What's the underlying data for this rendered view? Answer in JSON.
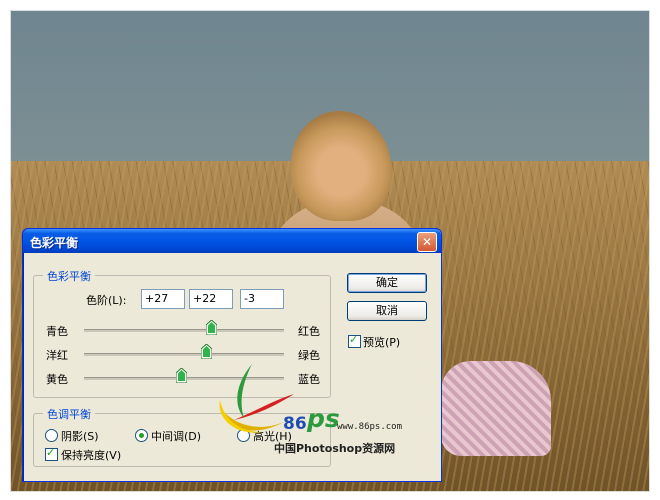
{
  "dialog": {
    "title": "色彩平衡",
    "close_glyph": "✕",
    "color_balance_group": {
      "label": "色彩平衡",
      "levels_label": "色阶(L):",
      "values": [
        "+27",
        "+22",
        "-3"
      ]
    },
    "sliders": [
      {
        "left": "青色",
        "right": "红色",
        "value": 27
      },
      {
        "left": "洋红",
        "right": "绿色",
        "value": 22
      },
      {
        "left": "黄色",
        "right": "蓝色",
        "value": -3
      }
    ],
    "tone_group": {
      "label": "色调平衡",
      "shadows": "阴影(S)",
      "midtones": "中间调(D)",
      "highlights": "高光(H)",
      "selected": "midtones",
      "preserve_luminosity": "保持亮度(V)",
      "preserve_checked": true
    },
    "buttons": {
      "ok": "确定",
      "cancel": "取消"
    },
    "preview": {
      "label": "预览(P)",
      "checked": true
    }
  },
  "watermark": {
    "number": "86",
    "letters": "ps",
    "site": "www.86ps.com",
    "name": "中国Photoshop资源网"
  },
  "colors": {
    "accent": "#0054e3",
    "group_label": "#0046d5",
    "dialog_bg": "#ece9d8"
  }
}
